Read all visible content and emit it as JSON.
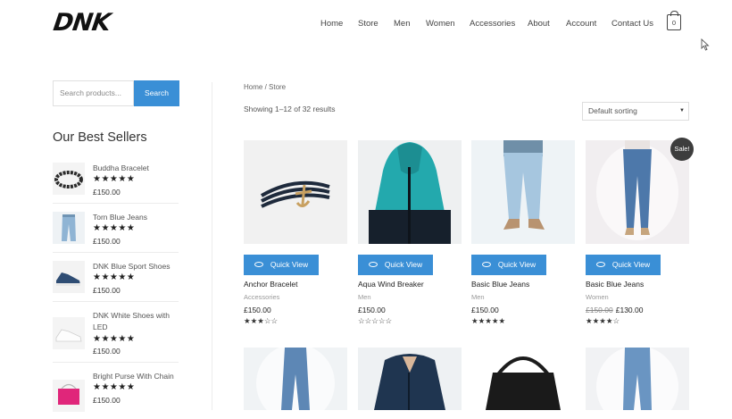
{
  "brand": {
    "logo_text": "DNK"
  },
  "nav": [
    {
      "label": "Home"
    },
    {
      "label": "Store"
    },
    {
      "label": "Men"
    },
    {
      "label": "Women"
    },
    {
      "label": "Accessories"
    },
    {
      "label": "About"
    },
    {
      "label": "Account"
    },
    {
      "label": "Contact Us"
    }
  ],
  "cart": {
    "count": "0"
  },
  "search": {
    "placeholder": "Search products...",
    "button_label": "Search"
  },
  "sidebar": {
    "title": "Our Best Sellers",
    "items": [
      {
        "name": "Buddha Bracelet",
        "stars": "★★★★★",
        "price": "£150.00"
      },
      {
        "name": "Torn Blue Jeans",
        "stars": "★★★★★",
        "price": "£150.00"
      },
      {
        "name": "DNK Blue Sport Shoes",
        "stars": "★★★★★",
        "price": "£150.00"
      },
      {
        "name": "DNK White Shoes with LED",
        "stars": "★★★★★",
        "price": "£150.00"
      },
      {
        "name": "Bright Purse With Chain",
        "stars": "★★★★★",
        "price": "£150.00"
      }
    ]
  },
  "shop": {
    "breadcrumb": "Home / Store",
    "result_count": "Showing 1–12 of 32 results",
    "sorting": "Default sorting"
  },
  "products": [
    {
      "name": "Anchor Bracelet",
      "category": "Accessories",
      "price": "£150.00",
      "old_price": "",
      "stars": "★★★☆☆",
      "quick_view": "Quick View",
      "sale": ""
    },
    {
      "name": "Aqua Wind Breaker",
      "category": "Men",
      "price": "£150.00",
      "old_price": "",
      "stars": "☆☆☆☆☆",
      "quick_view": "Quick View",
      "sale": ""
    },
    {
      "name": "Basic Blue Jeans",
      "category": "Men",
      "price": "£150.00",
      "old_price": "",
      "stars": "★★★★★",
      "quick_view": "Quick View",
      "sale": ""
    },
    {
      "name": "Basic Blue Jeans",
      "category": "Women",
      "price": "£130.00",
      "old_price": "£150.00",
      "stars": "★★★★☆",
      "quick_view": "Quick View",
      "sale": "Sale!"
    }
  ],
  "colors": {
    "accent": "#3a8fd6",
    "sale_badge": "#3d3d3d"
  }
}
